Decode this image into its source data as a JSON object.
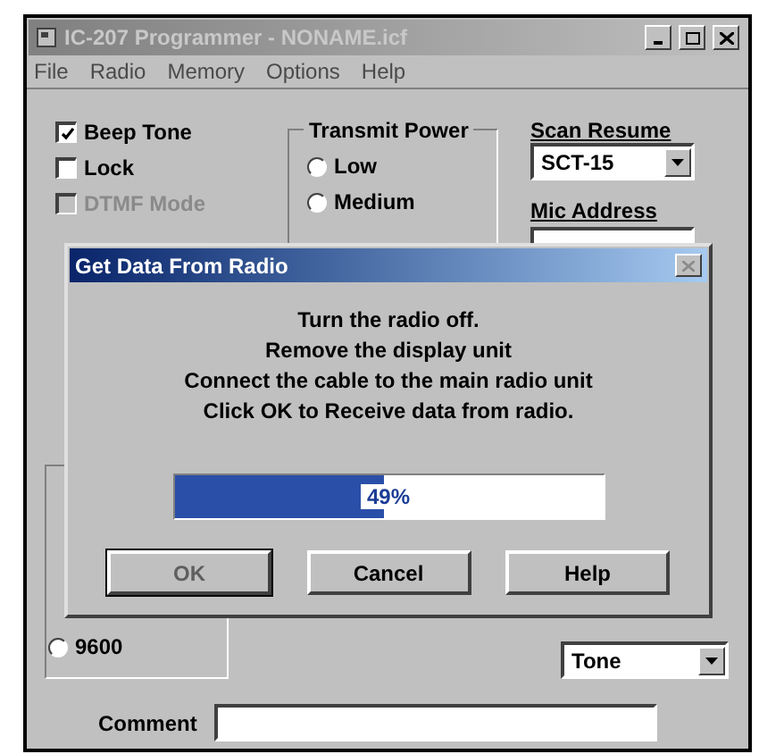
{
  "window": {
    "title": "IC-207 Programmer - NONAME.icf"
  },
  "menu": [
    "File",
    "Radio",
    "Memory",
    "Options",
    "Help"
  ],
  "checkboxes": [
    {
      "label": "Beep Tone",
      "checked": true,
      "disabled": false
    },
    {
      "label": "Lock",
      "checked": false,
      "disabled": false
    },
    {
      "label": "DTMF Mode",
      "checked": false,
      "disabled": true
    }
  ],
  "transmit_power": {
    "title": "Transmit Power",
    "options": [
      {
        "label": "Low",
        "selected": false
      },
      {
        "label": "Medium",
        "selected": false
      }
    ]
  },
  "scan_resume": {
    "label": "Scan Resume",
    "value": "SCT-15"
  },
  "mic_address": {
    "label": "Mic Address"
  },
  "baud_group": {
    "options": [
      {
        "label": "9600",
        "selected": false
      }
    ]
  },
  "tone_select": {
    "value": "Tone"
  },
  "comment": {
    "label": "Comment"
  },
  "dialog": {
    "title": "Get Data From Radio",
    "lines": [
      "Turn the radio off.",
      "Remove the display unit",
      "Connect the cable to the main radio unit",
      "Click OK to Receive data from radio."
    ],
    "progress": {
      "level": 0.49,
      "reading": "49%"
    },
    "buttons": [
      {
        "label": "OK",
        "disabled": true
      },
      {
        "label": "Cancel",
        "disabled": false
      },
      {
        "label": "Help",
        "disabled": false
      }
    ]
  }
}
